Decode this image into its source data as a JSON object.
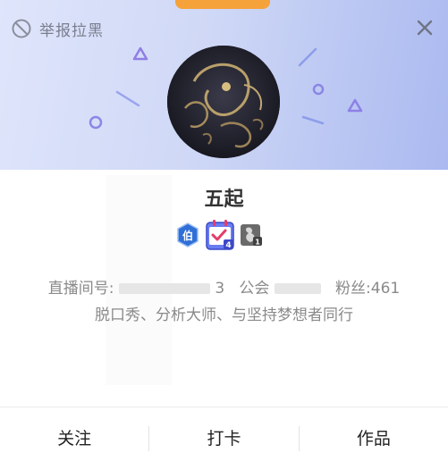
{
  "header": {
    "report_block_label": "举报拉黑",
    "report_icon": "block-icon",
    "close_icon": "close-icon",
    "tab_color": "#f5a23a"
  },
  "profile": {
    "name": "五起",
    "avatar_alt": "avatar",
    "badges": [
      {
        "icon": "noble-badge-icon",
        "text": "伯",
        "color": "#2f6fd6"
      },
      {
        "icon": "checkin-calendar-icon",
        "text": "4",
        "color": "#5a6cf0"
      },
      {
        "icon": "fan-level-icon",
        "text": "1",
        "color": "#555555"
      }
    ]
  },
  "info": {
    "room_label": "直播间号:",
    "room_visible_tail": "3",
    "guild_label": "公会",
    "fans_label": "粉丝:",
    "fans_count": "461",
    "bio": "脱口秀、分析大师、与坚持梦想者同行"
  },
  "actions": {
    "follow": "关注",
    "checkin": "打卡",
    "works": "作品"
  }
}
